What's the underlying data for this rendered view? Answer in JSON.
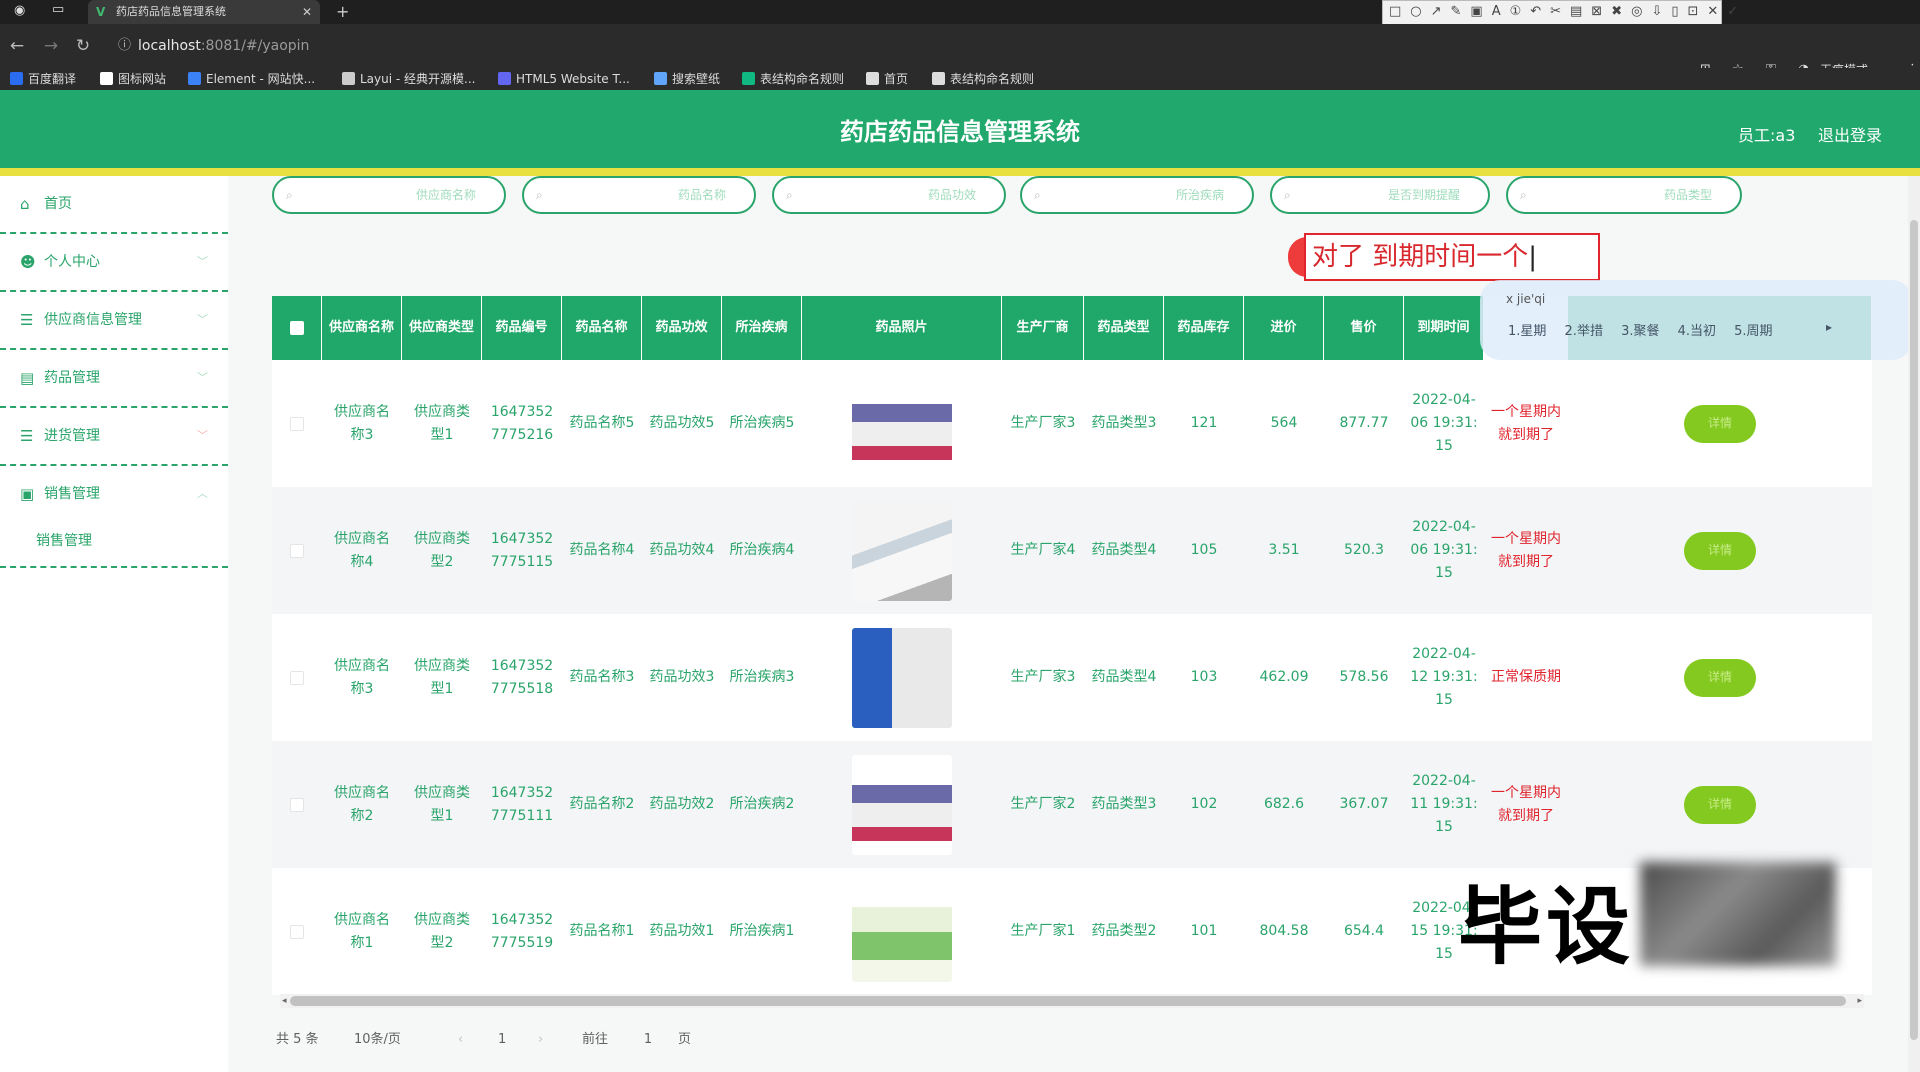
{
  "browser": {
    "tab_title": "药店药品信息管理系统",
    "tab_favicon": "V",
    "url_host": "localhost",
    "url_rest": ":8081/#/yaopin",
    "bookmarks": [
      "百度翻译",
      "图标网站",
      "Element - 网站快...",
      "Layui - 经典开源模...",
      "HTML5 Website T...",
      "搜索壁纸",
      "表结构命名规则",
      "首页",
      "表结构命名规则"
    ],
    "incognito_label": "无痕模式",
    "annot_size": "20",
    "annot_colors": [
      "#e62929",
      "#1a1a1a",
      "#666666",
      "#c0392b",
      "#e67e22",
      "#f1c40f",
      "#27ae60",
      "#2980b9",
      "#8e44ad",
      "#e91e63",
      "#16a085",
      "#3498db"
    ]
  },
  "header": {
    "title": "药店药品信息管理系统",
    "user": "员工:a3",
    "logout": "退出登录"
  },
  "sidebar": {
    "items": [
      {
        "label": "首页",
        "icon": "home-icon"
      },
      {
        "label": "个人中心",
        "icon": "user-icon"
      },
      {
        "label": "供应商信息管理",
        "icon": "menu-icon"
      },
      {
        "label": "药品管理",
        "icon": "doc-icon"
      },
      {
        "label": "进货管理",
        "icon": "menu-icon"
      },
      {
        "label": "销售管理",
        "icon": "chat-icon"
      }
    ],
    "sub_item": "销售管理"
  },
  "search": {
    "pills": [
      "供应商名称",
      "药品名称",
      "药品功效",
      "所治疾病",
      "是否到期提醒",
      "药品类型"
    ]
  },
  "ime": {
    "composition": "对了 到期时间一个",
    "candidate_header": "x jie'qi",
    "candidates": "1.星期 2.举措 3.聚餐 4.当初 5.周期"
  },
  "table": {
    "headers": [
      "供应商名称",
      "供应商类型",
      "药品编号",
      "药品名称",
      "药品功效",
      "所治疾病",
      "药品照片",
      "生产厂商",
      "药品类型",
      "药品库存",
      "进价",
      "售价",
      "到期时间"
    ],
    "detail_label": "详情",
    "rows": [
      {
        "supplier": "供应商名称3",
        "type": "供应商类型1",
        "code": "16473527775216",
        "name": "药品名称5",
        "effect": "药品功效5",
        "disease": "所治疾病5",
        "maker": "生产厂家3",
        "ptype": "药品类型3",
        "stock": "121",
        "cost": "564",
        "price": "877.77",
        "expire": "2022-04-06 19:31:15",
        "status": "一个星期内就到期了",
        "status_red": true,
        "img": "box-red"
      },
      {
        "supplier": "供应商名称4",
        "type": "供应商类型2",
        "code": "16473527775115",
        "name": "药品名称4",
        "effect": "药品功效4",
        "disease": "所治疾病4",
        "maker": "生产厂家4",
        "ptype": "药品类型4",
        "stock": "105",
        "cost": "3.51",
        "price": "520.3",
        "expire": "2022-04-06 19:31:15",
        "status": "一个星期内就到期了",
        "status_red": true,
        "img": "box-white"
      },
      {
        "supplier": "供应商名称3",
        "type": "供应商类型1",
        "code": "16473527775518",
        "name": "药品名称3",
        "effect": "药品功效3",
        "disease": "所治疾病3",
        "maker": "生产厂家3",
        "ptype": "药品类型4",
        "stock": "103",
        "cost": "462.09",
        "price": "578.56",
        "expire": "2022-04-12 19:31:15",
        "status": "正常保质期",
        "status_red": false,
        "img": "box-blue"
      },
      {
        "supplier": "供应商名称2",
        "type": "供应商类型1",
        "code": "16473527775111",
        "name": "药品名称2",
        "effect": "药品功效2",
        "disease": "所治疾病2",
        "maker": "生产厂家2",
        "ptype": "药品类型3",
        "stock": "102",
        "cost": "682.6",
        "price": "367.07",
        "expire": "2022-04-11 19:31:15",
        "status": "一个星期内就到期了",
        "status_red": true,
        "img": "box-red"
      },
      {
        "supplier": "供应商名称1",
        "type": "供应商类型2",
        "code": "16473527775519",
        "name": "药品名称1",
        "effect": "药品功效1",
        "disease": "所治疾病1",
        "maker": "生产厂家1",
        "ptype": "药品类型2",
        "stock": "101",
        "cost": "804.58",
        "price": "654.4",
        "expire": "2022-04-15 19:31:15",
        "status": "",
        "status_red": false,
        "img": "box-green"
      }
    ]
  },
  "pager": {
    "total": "共 5 条",
    "page_size": "10条/页",
    "current": "1",
    "goto_prefix": "前往",
    "goto_value": "1",
    "goto_suffix": "页"
  },
  "watermark": "毕设"
}
